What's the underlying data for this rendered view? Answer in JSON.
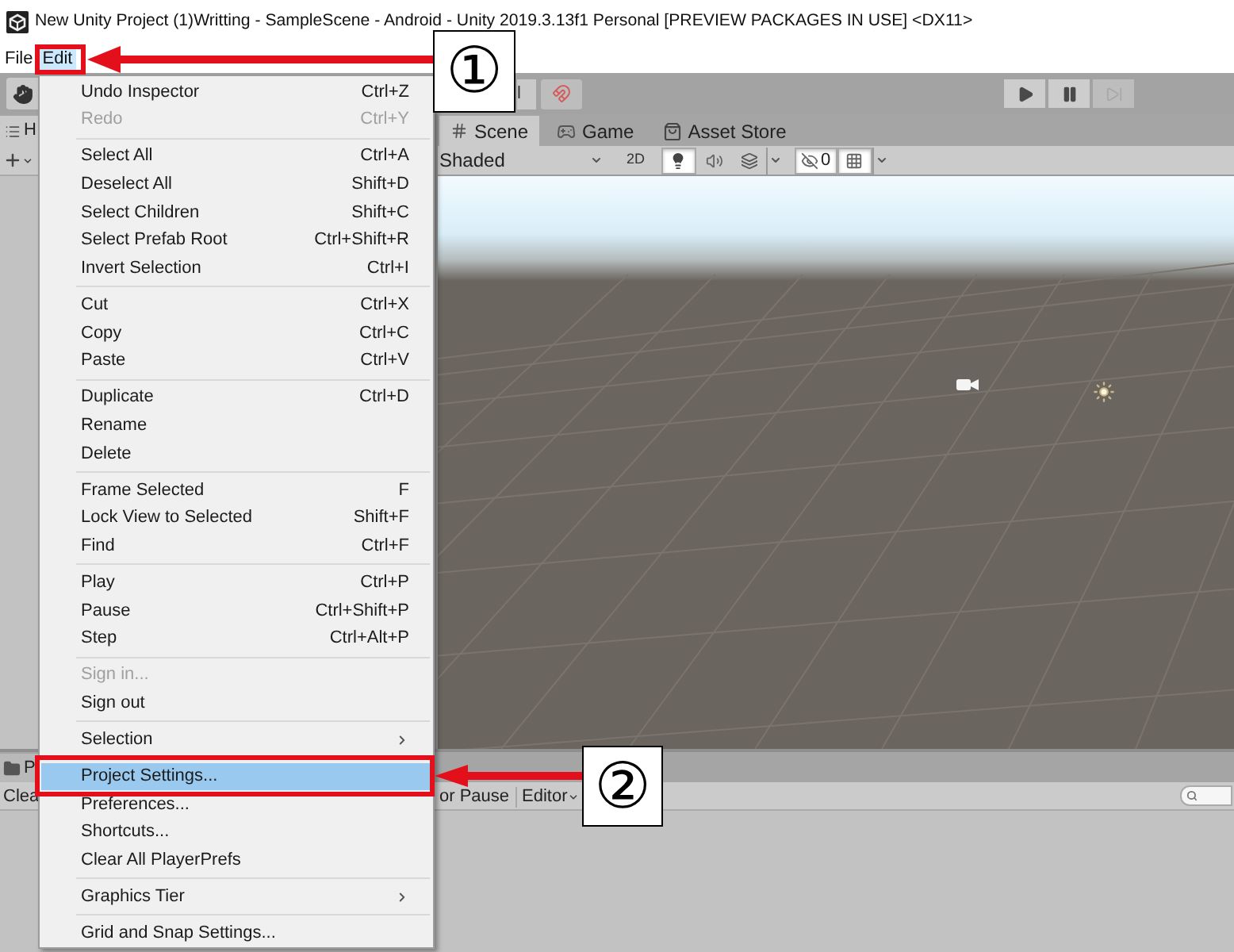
{
  "window": {
    "title": "New Unity Project (1)Writting - SampleScene - Android - Unity 2019.3.13f1 Personal [PREVIEW PACKAGES IN USE] <DX11>"
  },
  "menubar": [
    {
      "label": "File",
      "selected": false
    },
    {
      "label": "Edit",
      "selected": true
    }
  ],
  "toolbar": {
    "toggle_label": "l",
    "play_controls": [
      {
        "kind": "play",
        "disabled": false
      },
      {
        "kind": "pause",
        "disabled": false
      },
      {
        "kind": "step",
        "disabled": true
      }
    ]
  },
  "hierarchy": {
    "tab_label": "H"
  },
  "scene_tabs": [
    {
      "kind": "scene",
      "label": "Scene",
      "selected": true
    },
    {
      "kind": "game",
      "label": "Game",
      "selected": false
    },
    {
      "kind": "store",
      "label": "Asset Store",
      "selected": false
    }
  ],
  "scene_toolbar": {
    "draw_mode": "Shaded",
    "toggles": [
      {
        "kind": "dimension",
        "label": "2D",
        "pressed": false
      },
      {
        "kind": "lighting",
        "pressed": true
      },
      {
        "kind": "audio",
        "pressed": false
      },
      {
        "kind": "effects",
        "pressed": false
      },
      {
        "kind": "visibility",
        "label": "0",
        "pressed": true
      },
      {
        "kind": "gizmos",
        "pressed": true
      }
    ]
  },
  "bottom_panel": {
    "tab_label": "P",
    "clear_button": "Clea",
    "toolbar_items": [
      {
        "kind": "toggle",
        "label": "or Pause"
      },
      {
        "kind": "dropdown",
        "label": "Editor"
      }
    ]
  },
  "edit_menu": [
    {
      "kind": "item",
      "label": "Undo Inspector",
      "shortcut": "Ctrl+Z",
      "disabled": false,
      "selected": false
    },
    {
      "kind": "item",
      "label": "Redo",
      "shortcut": "Ctrl+Y",
      "disabled": true,
      "selected": false
    },
    {
      "kind": "separator"
    },
    {
      "kind": "item",
      "label": "Select All",
      "shortcut": "Ctrl+A",
      "disabled": false,
      "selected": false
    },
    {
      "kind": "item",
      "label": "Deselect All",
      "shortcut": "Shift+D",
      "disabled": false,
      "selected": false
    },
    {
      "kind": "item",
      "label": "Select Children",
      "shortcut": "Shift+C",
      "disabled": false,
      "selected": false
    },
    {
      "kind": "item",
      "label": "Select Prefab Root",
      "shortcut": "Ctrl+Shift+R",
      "disabled": false,
      "selected": false
    },
    {
      "kind": "item",
      "label": "Invert Selection",
      "shortcut": "Ctrl+I",
      "disabled": false,
      "selected": false
    },
    {
      "kind": "separator"
    },
    {
      "kind": "item",
      "label": "Cut",
      "shortcut": "Ctrl+X",
      "disabled": false,
      "selected": false
    },
    {
      "kind": "item",
      "label": "Copy",
      "shortcut": "Ctrl+C",
      "disabled": false,
      "selected": false
    },
    {
      "kind": "item",
      "label": "Paste",
      "shortcut": "Ctrl+V",
      "disabled": false,
      "selected": false
    },
    {
      "kind": "separator"
    },
    {
      "kind": "item",
      "label": "Duplicate",
      "shortcut": "Ctrl+D",
      "disabled": false,
      "selected": false
    },
    {
      "kind": "item",
      "label": "Rename",
      "disabled": false,
      "selected": false
    },
    {
      "kind": "item",
      "label": "Delete",
      "disabled": false,
      "selected": false
    },
    {
      "kind": "separator"
    },
    {
      "kind": "item",
      "label": "Frame Selected",
      "shortcut": "F",
      "disabled": false,
      "selected": false
    },
    {
      "kind": "item",
      "label": "Lock View to Selected",
      "shortcut": "Shift+F",
      "disabled": false,
      "selected": false
    },
    {
      "kind": "item",
      "label": "Find",
      "shortcut": "Ctrl+F",
      "disabled": false,
      "selected": false
    },
    {
      "kind": "separator"
    },
    {
      "kind": "item",
      "label": "Play",
      "shortcut": "Ctrl+P",
      "disabled": false,
      "selected": false
    },
    {
      "kind": "item",
      "label": "Pause",
      "shortcut": "Ctrl+Shift+P",
      "disabled": false,
      "selected": false
    },
    {
      "kind": "item",
      "label": "Step",
      "shortcut": "Ctrl+Alt+P",
      "disabled": false,
      "selected": false
    },
    {
      "kind": "separator"
    },
    {
      "kind": "item",
      "label": "Sign in...",
      "disabled": true,
      "selected": false
    },
    {
      "kind": "item",
      "label": "Sign out",
      "disabled": false,
      "selected": false
    },
    {
      "kind": "separator"
    },
    {
      "kind": "submenu",
      "label": "Selection",
      "disabled": false,
      "selected": false
    },
    {
      "kind": "separator"
    },
    {
      "kind": "item",
      "label": "Project Settings...",
      "disabled": false,
      "selected": true
    },
    {
      "kind": "item",
      "label": "Preferences...",
      "disabled": false,
      "selected": false
    },
    {
      "kind": "item",
      "label": "Shortcuts...",
      "disabled": false,
      "selected": false
    },
    {
      "kind": "item",
      "label": "Clear All PlayerPrefs",
      "disabled": false,
      "selected": false
    },
    {
      "kind": "separator"
    },
    {
      "kind": "submenu",
      "label": "Graphics Tier",
      "disabled": false,
      "selected": false
    },
    {
      "kind": "separator"
    },
    {
      "kind": "item",
      "label": "Grid and Snap Settings...",
      "disabled": false,
      "selected": false
    }
  ],
  "callouts": [
    {
      "label": "①"
    },
    {
      "label": "②"
    }
  ]
}
